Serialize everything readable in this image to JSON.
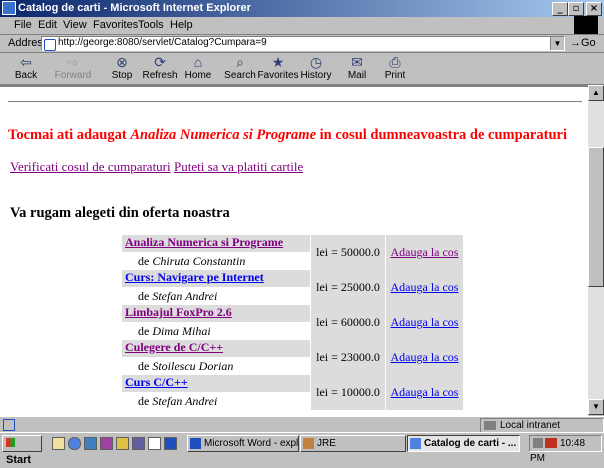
{
  "window": {
    "title": "Catalog de carti - Microsoft Internet Explorer"
  },
  "menu": [
    {
      "label": "File",
      "key": "F"
    },
    {
      "label": "Edit",
      "key": "E"
    },
    {
      "label": "View",
      "key": "V"
    },
    {
      "label": "Favorites",
      "key": "a"
    },
    {
      "label": "Tools",
      "key": "T"
    },
    {
      "label": "Help",
      "key": "H"
    }
  ],
  "address": {
    "label": "Address",
    "url": "http://george:8080/servlet/Catalog?Cumpara=9",
    "go_label": "Go"
  },
  "toolbar": {
    "back": "Back",
    "forward": "Forward",
    "stop": "Stop",
    "refresh": "Refresh",
    "home": "Home",
    "search": "Search",
    "favorites": "Favorites",
    "history": "History",
    "mail": "Mail",
    "print": "Print"
  },
  "page": {
    "message_prefix": "Tocmai ati adaugat ",
    "message_title": "Analiza Numerica si Programe",
    "message_suffix": " in cosul dumneavoastra de cumparaturi",
    "link_cart": "Verificati cosul de cumparaturi",
    "link_pay": "Puteti sa va platiti cartile",
    "heading": "Va rugam alegeti din oferta noastra",
    "add_label": "Adauga la cos",
    "by_label": "de",
    "books": [
      {
        "title": "Analiza Numerica si Programe",
        "author": "Chiruta Constantin",
        "price": "lei = 50000.0"
      },
      {
        "title": "Curs: Navigare pe Internet",
        "author": "Stefan Andrei",
        "price": "lei = 25000.0"
      },
      {
        "title": "Limbajul FoxPro 2.6",
        "author": "Dima Mihai",
        "price": "lei = 60000.0"
      },
      {
        "title": "Culegere de C/C++",
        "author": "Stoilescu Dorian",
        "price": "lei = 23000.0"
      },
      {
        "title": "Curs C/C++",
        "author": "Stefan Andrei",
        "price": "lei = 10000.0"
      }
    ]
  },
  "status": {
    "zone": "Local intranet"
  },
  "taskbar": {
    "start": "Start",
    "tasks": [
      "Microsoft Word - explic...",
      "JRE",
      "Catalog de carti - ..."
    ],
    "clock": "10:48 PM"
  },
  "colors": {
    "titlebar": "#0a246a",
    "message": "#ff0000",
    "visited": "#800080",
    "link": "#0000ee"
  }
}
